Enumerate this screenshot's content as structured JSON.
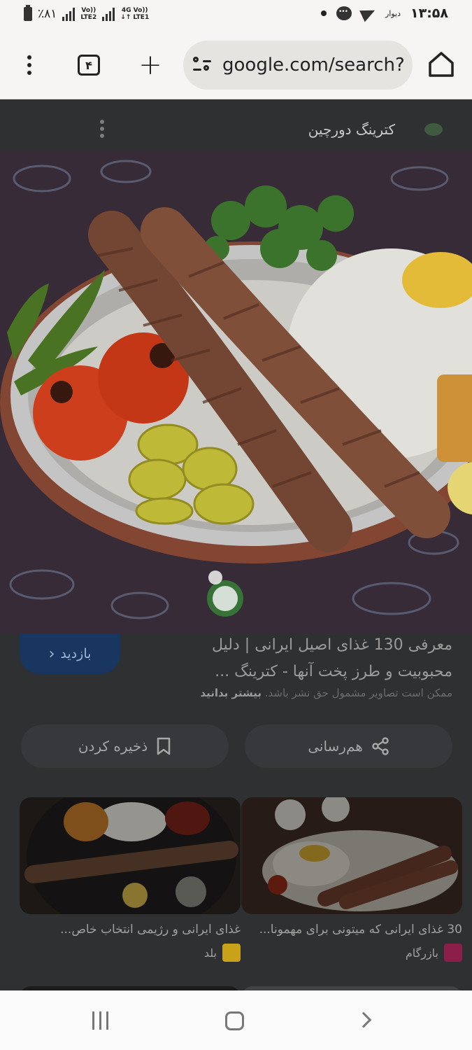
{
  "status_bar": {
    "battery": "٪۸۱",
    "net1_top": "Vo))",
    "net1_bottom": "LTE2",
    "net2_top": "4G Vo))",
    "net2_bottom": "↓↑ LTE1",
    "app_label": "دیوار",
    "time": "۱۳:۵۸"
  },
  "toolbar": {
    "tab_count": "۴",
    "url": "google.com/search?"
  },
  "result": {
    "source_name": "کترینگ دورچین",
    "visit_label": "بازدید",
    "title": "معرفی 130 غذای اصیل ایرانی | دلیل محبوبیت و طرز پخت آنها - کترینگ ...",
    "disclaimer": "ممکن است تصاویر مشمول حق نشر باشد.",
    "learn_more": "بیشتر بدانید",
    "share_label": "هم‌رسانی",
    "save_label": "ذخیره کردن"
  },
  "related": [
    {
      "title": "30 غذای ایرانی که میتونی برای مهمونا...",
      "source": "بازرگام"
    },
    {
      "title": "غذای ایرانی و رژیمی انتخاب خاص...",
      "source": "بلد"
    }
  ],
  "colors": {
    "visit_button": "#18365f",
    "page_bg": "#2e3032",
    "chrome_bg": "#f6f5f4"
  }
}
